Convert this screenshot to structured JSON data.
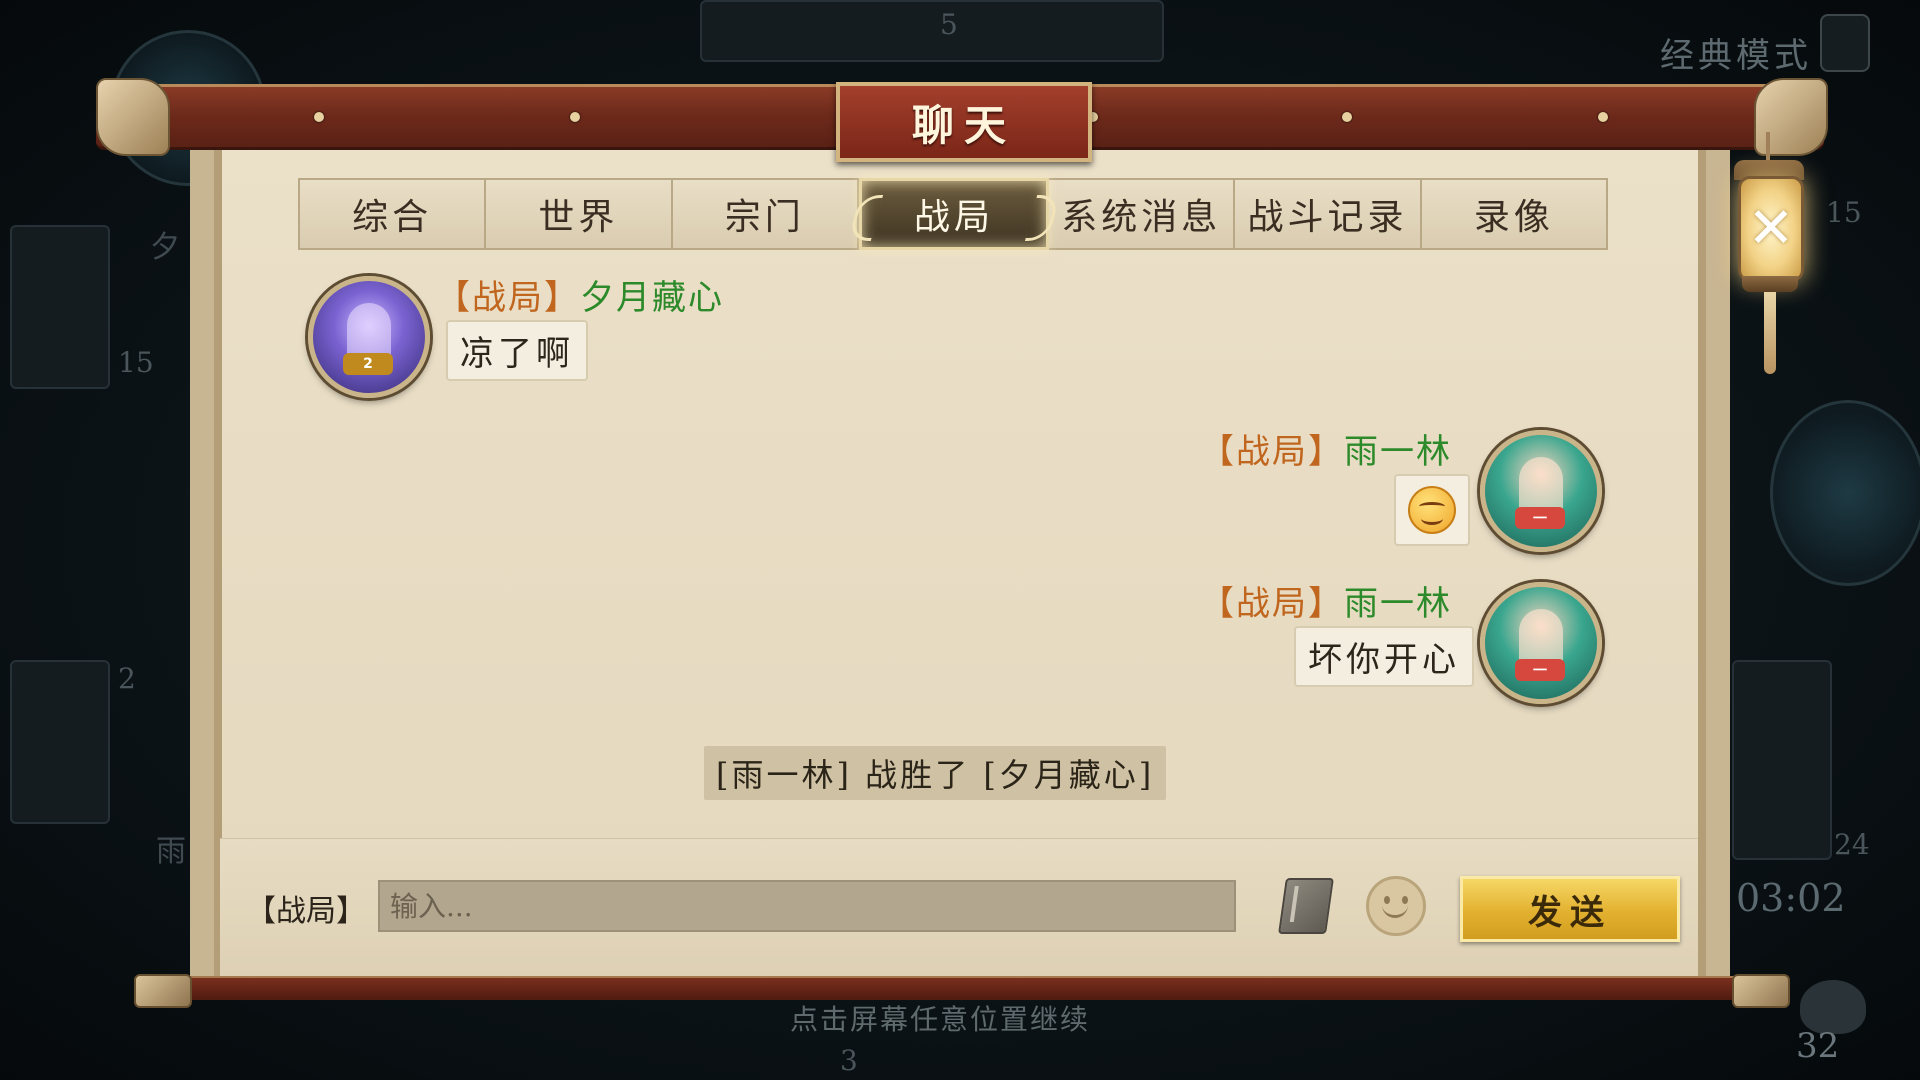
{
  "dialog": {
    "title": "聊天"
  },
  "tabs": [
    {
      "label": "综合"
    },
    {
      "label": "世界"
    },
    {
      "label": "宗门"
    },
    {
      "label": "战局",
      "active": true
    },
    {
      "label": "系统消息"
    },
    {
      "label": "战斗记录"
    },
    {
      "label": "录像"
    }
  ],
  "messages": [
    {
      "channel": "【战局】",
      "sender": "夕月藏心",
      "text": "凉了啊",
      "side": "left"
    },
    {
      "channel": "【战局】",
      "sender": "雨一林",
      "emoji": "grinning-face-emoji",
      "side": "right"
    },
    {
      "channel": "【战局】",
      "sender": "雨一林",
      "text": "坏你开心",
      "side": "right"
    }
  ],
  "system_message": "[雨一林] 战胜了 [夕月藏心]",
  "input_bar": {
    "channel_label": "【战局】",
    "placeholder": "输入...",
    "value": "",
    "send_label": "发送"
  },
  "close_icon": "close-icon",
  "background": {
    "mode_label": "经典模式",
    "timer": "03:02",
    "continue_hint": "点击屏幕任意位置继续",
    "counts": [
      "5",
      "15",
      "15",
      "2",
      "24",
      "3",
      "32"
    ],
    "side_names": [
      "夕",
      "雨"
    ]
  },
  "colors": {
    "channel_tag": "#c0661e",
    "sender_name": "#2d8a2a",
    "send_button": "#e3b130",
    "title_plate": "#8f2f20"
  }
}
